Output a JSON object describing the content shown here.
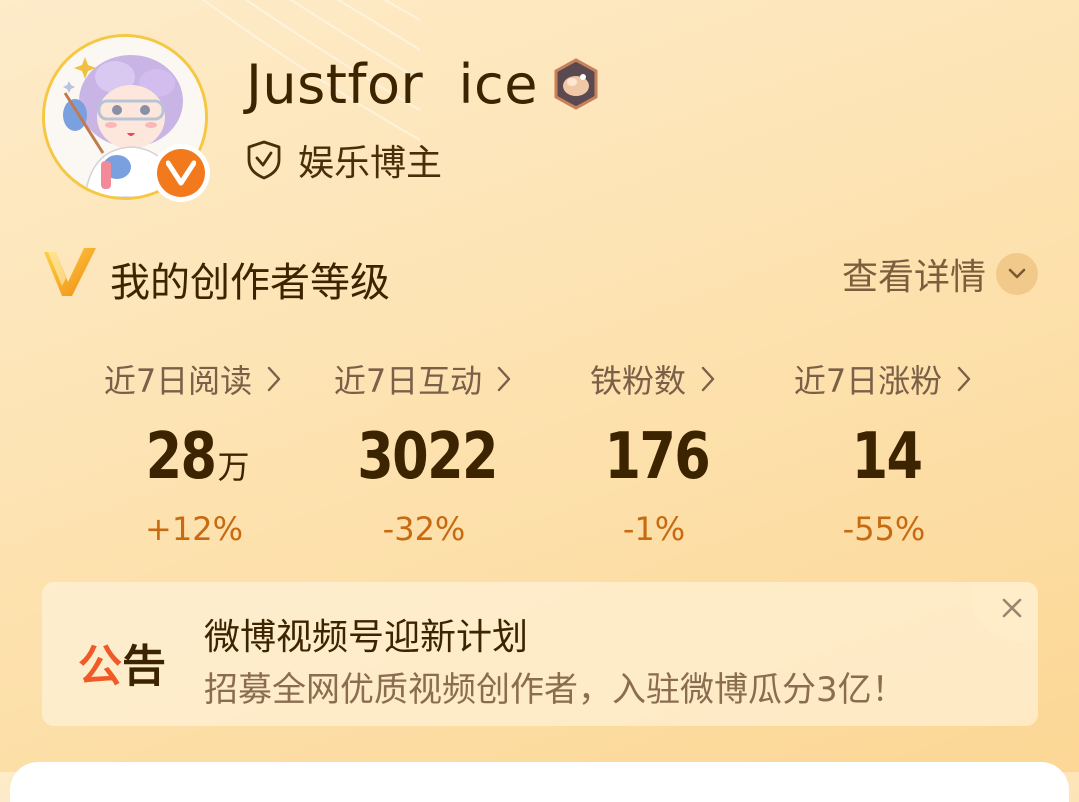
{
  "colors": {
    "accent": "#f37a1c",
    "text_primary": "#3d2400",
    "text_secondary": "#7a6048",
    "change": "#c86a10",
    "announce_tag": "#f05a28"
  },
  "profile": {
    "username": "Justfor  ice",
    "level_icon": "level-medal-icon",
    "verified_icon": "vip-v-icon",
    "role": "娱乐博主",
    "role_icon": "shield-check-icon"
  },
  "creator_level": {
    "title": "我的创作者等级",
    "details_link": "查看详情"
  },
  "stats": [
    {
      "label": "近7日阅读",
      "value": "28",
      "unit": "万",
      "change": "+12%"
    },
    {
      "label": "近7日互动",
      "value": "3022",
      "unit": "",
      "change": "-32%"
    },
    {
      "label": "铁粉数",
      "value": "176",
      "unit": "",
      "change": "-1%"
    },
    {
      "label": "近7日涨粉",
      "value": "14",
      "unit": "",
      "change": "-55%"
    }
  ],
  "announcement": {
    "tag_part1": "公",
    "tag_part2": "告",
    "title": "微博视频号迎新计划",
    "subtitle": "招募全网优质视频创作者，入驻微博瓜分3亿！"
  }
}
